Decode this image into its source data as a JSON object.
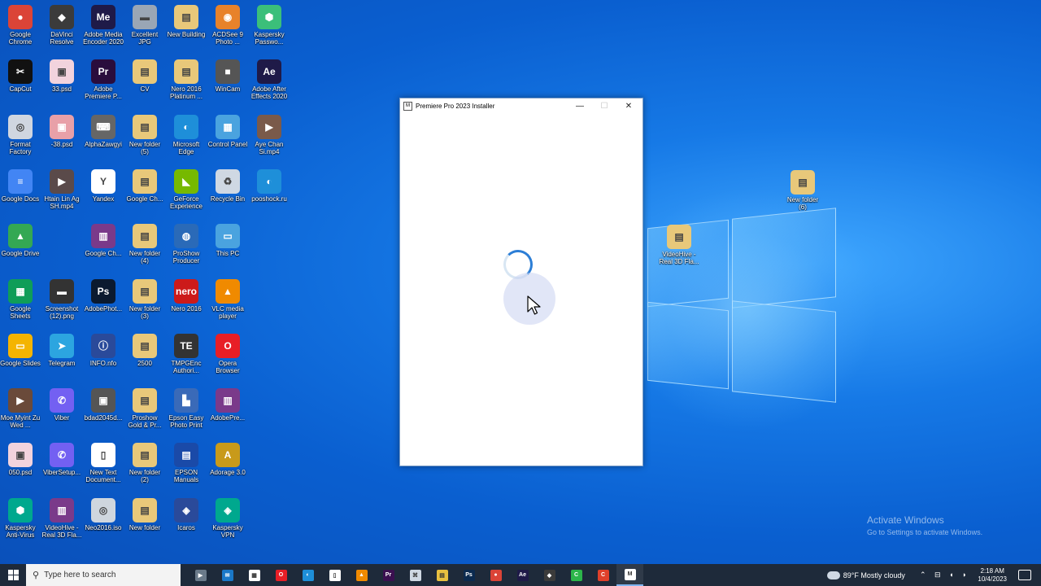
{
  "desktop_icons": [
    {
      "label": "Google Chrome",
      "color": "#db4437",
      "glyph": "●"
    },
    {
      "label": "DaVinci Resolve",
      "color": "#3b3b3b",
      "glyph": "◆"
    },
    {
      "label": "Adobe Media Encoder 2020",
      "color": "#1f1a48",
      "glyph": "Me"
    },
    {
      "label": "Excellent JPG",
      "color": "#9aa6b5",
      "glyph": "▬"
    },
    {
      "label": "New Building",
      "color": "#e8c87a",
      "glyph": "▤"
    },
    {
      "label": "ACDSee 9 Photo ...",
      "color": "#e8822a",
      "glyph": "◉"
    },
    {
      "label": "Kaspersky Passwo...",
      "color": "#3bbf7a",
      "glyph": "⬢"
    },
    {
      "label": "CapCut",
      "color": "#111111",
      "glyph": "✂"
    },
    {
      "label": "33.psd",
      "color": "#f2d3dd",
      "glyph": "▣"
    },
    {
      "label": "Adobe Premiere P...",
      "color": "#2a0d3d",
      "glyph": "Pr"
    },
    {
      "label": "CV",
      "color": "#e8c87a",
      "glyph": "▤"
    },
    {
      "label": "Nero 2016 Platinum ...",
      "color": "#e8c87a",
      "glyph": "▤"
    },
    {
      "label": "WinCam",
      "color": "#555555",
      "glyph": "■"
    },
    {
      "label": "Adobe After Effects 2020",
      "color": "#1f1a48",
      "glyph": "Ae"
    },
    {
      "label": "Format Factory",
      "color": "#d0d6e0",
      "glyph": "◎"
    },
    {
      "label": "-38.psd",
      "color": "#e8a0a8",
      "glyph": "▣"
    },
    {
      "label": "AlphaZawgyi",
      "color": "#666666",
      "glyph": "⌨"
    },
    {
      "label": "New folder (5)",
      "color": "#e8c87a",
      "glyph": "▤"
    },
    {
      "label": "Microsoft Edge",
      "color": "#1e8fd9",
      "glyph": "◐"
    },
    {
      "label": "Control Panel",
      "color": "#4aa3df",
      "glyph": "▦"
    },
    {
      "label": "Aye Chan Si.mp4",
      "color": "#7a5a4a",
      "glyph": "▶"
    },
    {
      "label": "Google Docs",
      "color": "#4285f4",
      "glyph": "≡"
    },
    {
      "label": "Htain Lin Ag SH.mp4",
      "color": "#5a4a4a",
      "glyph": "▶"
    },
    {
      "label": "Yandex",
      "color": "#ffffff",
      "glyph": "Y"
    },
    {
      "label": "Google Ch...",
      "color": "#e8c87a",
      "glyph": "▤"
    },
    {
      "label": "GeForce Experience",
      "color": "#76b900",
      "glyph": "◣"
    },
    {
      "label": "Recycle Bin",
      "color": "#cfd8e3",
      "glyph": "♻"
    },
    {
      "label": "pooshock.ru",
      "color": "#1e8fd9",
      "glyph": "◐"
    },
    {
      "label": "Google Drive",
      "color": "#34a853",
      "glyph": "▲"
    },
    {
      "label": "",
      "color": "transparent",
      "glyph": ""
    },
    {
      "label": "Google Ch...",
      "color": "#7a3a8a",
      "glyph": "▥"
    },
    {
      "label": "New folder (4)",
      "color": "#e8c87a",
      "glyph": "▤"
    },
    {
      "label": "ProShow Producer",
      "color": "#2a6ab8",
      "glyph": "◍"
    },
    {
      "label": "This PC",
      "color": "#4aa3df",
      "glyph": "▭"
    },
    {
      "label": "",
      "color": "transparent",
      "glyph": ""
    },
    {
      "label": "Google Sheets",
      "color": "#0f9d58",
      "glyph": "▦"
    },
    {
      "label": "Screenshot (12).png",
      "color": "#333333",
      "glyph": "▬"
    },
    {
      "label": "AdobePhot...",
      "color": "#0b1a2f",
      "glyph": "Ps"
    },
    {
      "label": "New folder (3)",
      "color": "#e8c87a",
      "glyph": "▤"
    },
    {
      "label": "Nero 2016",
      "color": "#cc1a1a",
      "glyph": "nero"
    },
    {
      "label": "VLC media player",
      "color": "#f08a00",
      "glyph": "▲"
    },
    {
      "label": "",
      "color": "transparent",
      "glyph": ""
    },
    {
      "label": "Google Slides",
      "color": "#f4b400",
      "glyph": "▭"
    },
    {
      "label": "Telegram",
      "color": "#2ca5e0",
      "glyph": "➤"
    },
    {
      "label": "INFO.nfo",
      "color": "#2a4a9a",
      "glyph": "ⓘ"
    },
    {
      "label": "2500",
      "color": "#e8c87a",
      "glyph": "▤"
    },
    {
      "label": "TMPGEnc Authori...",
      "color": "#333333",
      "glyph": "TE"
    },
    {
      "label": "Opera Browser",
      "color": "#e81e26",
      "glyph": "O"
    },
    {
      "label": "",
      "color": "transparent",
      "glyph": ""
    },
    {
      "label": "Moe Myint Zu Wed ...",
      "color": "#6a4a3a",
      "glyph": "▶"
    },
    {
      "label": "Viber",
      "color": "#7360f2",
      "glyph": "✆"
    },
    {
      "label": "bdad2045d...",
      "color": "#555555",
      "glyph": "▣"
    },
    {
      "label": "Proshow Gold & Pr...",
      "color": "#e8c87a",
      "glyph": "▤"
    },
    {
      "label": "Epson Easy Photo Print",
      "color": "#3a6ab8",
      "glyph": "▙"
    },
    {
      "label": "AdobePre...",
      "color": "#7a3a8a",
      "glyph": "▥"
    },
    {
      "label": "",
      "color": "transparent",
      "glyph": ""
    },
    {
      "label": "050.psd",
      "color": "#f2d3dd",
      "glyph": "▣"
    },
    {
      "label": "ViberSetup...",
      "color": "#7360f2",
      "glyph": "✆"
    },
    {
      "label": "New Text Document...",
      "color": "#ffffff",
      "glyph": "▯"
    },
    {
      "label": "New folder (2)",
      "color": "#e8c87a",
      "glyph": "▤"
    },
    {
      "label": "EPSON Manuals",
      "color": "#1a4aa8",
      "glyph": "▤"
    },
    {
      "label": "Adorage 3.0",
      "color": "#c89a1a",
      "glyph": "A"
    },
    {
      "label": "",
      "color": "transparent",
      "glyph": ""
    },
    {
      "label": "Kaspersky Anti-Virus",
      "color": "#00a88e",
      "glyph": "⬢"
    },
    {
      "label": "VideoHive - Real 3D Fla...",
      "color": "#7a3a8a",
      "glyph": "▥"
    },
    {
      "label": "Neo2016.iso",
      "color": "#cfd6de",
      "glyph": "◎"
    },
    {
      "label": "New folder",
      "color": "#e8c87a",
      "glyph": "▤"
    },
    {
      "label": "Icaros",
      "color": "#2a4a9a",
      "glyph": "◈"
    },
    {
      "label": "Kaspersky VPN",
      "color": "#00a88e",
      "glyph": "◈"
    }
  ],
  "right_icons": [
    {
      "label": "New folder (6)",
      "color": "#e8c87a",
      "glyph": "▤"
    },
    {
      "label": "VideoHive - Real 3D Fla...",
      "color": "#e8c87a",
      "glyph": "▤"
    }
  ],
  "installer": {
    "title": "Premiere Pro 2023 Installer",
    "app_icon_glyph": "M",
    "min_glyph": "—",
    "max_glyph": "☐",
    "close_glyph": "✕"
  },
  "watermark": {
    "line1": "Activate Windows",
    "line2": "Go to Settings to activate Windows."
  },
  "taskbar": {
    "search_placeholder": "Type here to search",
    "apps": [
      {
        "name": "media-player",
        "glyph": "▶",
        "color": "#6a7a8a"
      },
      {
        "name": "mail",
        "glyph": "✉",
        "color": "#1a78c8"
      },
      {
        "name": "store",
        "glyph": "▦",
        "color": "#ffffff"
      },
      {
        "name": "opera",
        "glyph": "O",
        "color": "#e81e26"
      },
      {
        "name": "edge",
        "glyph": "◐",
        "color": "#1e8fd9"
      },
      {
        "name": "notepad",
        "glyph": "▯",
        "color": "#ffffff"
      },
      {
        "name": "vlc",
        "glyph": "▲",
        "color": "#f08a00"
      },
      {
        "name": "premiere",
        "glyph": "Pr",
        "color": "#3a1050"
      },
      {
        "name": "capture",
        "glyph": "⌘",
        "color": "#cfd8e3"
      },
      {
        "name": "explorer",
        "glyph": "▤",
        "color": "#e8c040"
      },
      {
        "name": "photoshop",
        "glyph": "Ps",
        "color": "#0b2a4f"
      },
      {
        "name": "chrome",
        "glyph": "●",
        "color": "#db4437"
      },
      {
        "name": "after-effects",
        "glyph": "Ae",
        "color": "#1f1a48"
      },
      {
        "name": "davinci",
        "glyph": "◆",
        "color": "#3b3b3b"
      },
      {
        "name": "camtasia",
        "glyph": "C",
        "color": "#2cb54a"
      },
      {
        "name": "capcut-red",
        "glyph": "C",
        "color": "#e0402a"
      },
      {
        "name": "installer",
        "glyph": "M",
        "color": "#ffffff"
      }
    ],
    "weather": "89°F  Mostly cloudy",
    "tray_icons": "⌃ ⊟ ◖ ◗",
    "time": "2:18 AM",
    "date": "10/4/2023"
  }
}
